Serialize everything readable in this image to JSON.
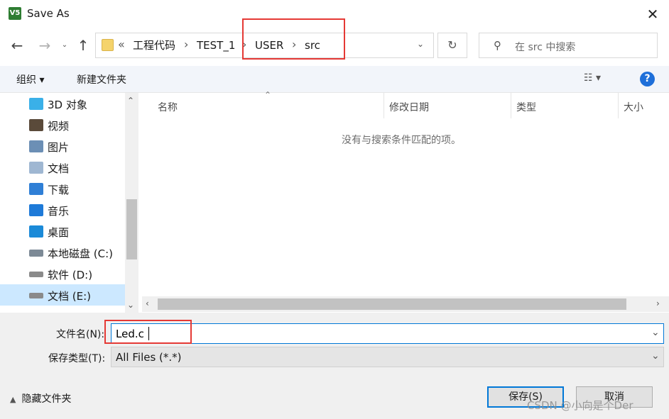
{
  "window": {
    "title": "Save As",
    "app_icon_text": "V5",
    "close_label": "✕"
  },
  "nav": {
    "back_glyph": "←",
    "forward_glyph": "→",
    "recent_glyph": "⌄",
    "up_glyph": "↑",
    "breadcrumb_overflow": "«",
    "breadcrumbs": [
      "工程代码",
      "TEST_1",
      "USER",
      "src"
    ],
    "breadcrumb_separator": "›",
    "address_dropdown_glyph": "⌄",
    "refresh_glyph": "↻",
    "search_icon": "⚲",
    "search_placeholder": "在 src 中搜索"
  },
  "toolbar": {
    "organize_label": "组织 ▾",
    "new_folder_label": "新建文件夹",
    "view_label": "☷ ▾",
    "help_glyph": "?"
  },
  "sidebar": {
    "items": [
      {
        "label": "3D 对象",
        "icon": "3d-objects-icon",
        "color": "#3ab0e8"
      },
      {
        "label": "视频",
        "icon": "video-icon",
        "color": "#5a4a3a"
      },
      {
        "label": "图片",
        "icon": "pictures-icon",
        "color": "#6c8fb5"
      },
      {
        "label": "文档",
        "icon": "documents-icon",
        "color": "#9fb7d2"
      },
      {
        "label": "下载",
        "icon": "downloads-icon",
        "color": "#2f7fd6"
      },
      {
        "label": "音乐",
        "icon": "music-icon",
        "color": "#1e7ad8"
      },
      {
        "label": "桌面",
        "icon": "desktop-icon",
        "color": "#1b8ad8"
      },
      {
        "label": "本地磁盘 (C:)",
        "icon": "drive-c-icon",
        "color": "#7d8a96"
      },
      {
        "label": "软件 (D:)",
        "icon": "drive-d-icon",
        "color": "#8a8a8a"
      },
      {
        "label": "文档 (E:)",
        "icon": "drive-e-icon",
        "color": "#8a8a8a"
      }
    ],
    "selected_index": 9,
    "scroll_up_glyph": "⌃",
    "scroll_down_glyph": "⌄"
  },
  "content": {
    "columns": [
      "名称",
      "修改日期",
      "类型",
      "大小"
    ],
    "sort_glyph": "⌃",
    "empty_message": "没有与搜索条件匹配的项。",
    "hscroll_left_glyph": "‹",
    "hscroll_right_glyph": "›"
  },
  "form": {
    "filename_label": "文件名(N):",
    "filename_value": "Led.c",
    "filetype_label": "保存类型(T):",
    "filetype_value": "All Files (*.*)",
    "dropdown_glyph": "⌄",
    "hide_folders_chevron": "▲",
    "hide_folders_label": "隐藏文件夹",
    "save_label": "保存(S)",
    "cancel_label": "取消"
  },
  "watermark": "CSDN @小向是个Der",
  "colors": {
    "accent": "#0078d7",
    "highlight_box": "#e53935",
    "selected_row": "#cce8ff"
  }
}
